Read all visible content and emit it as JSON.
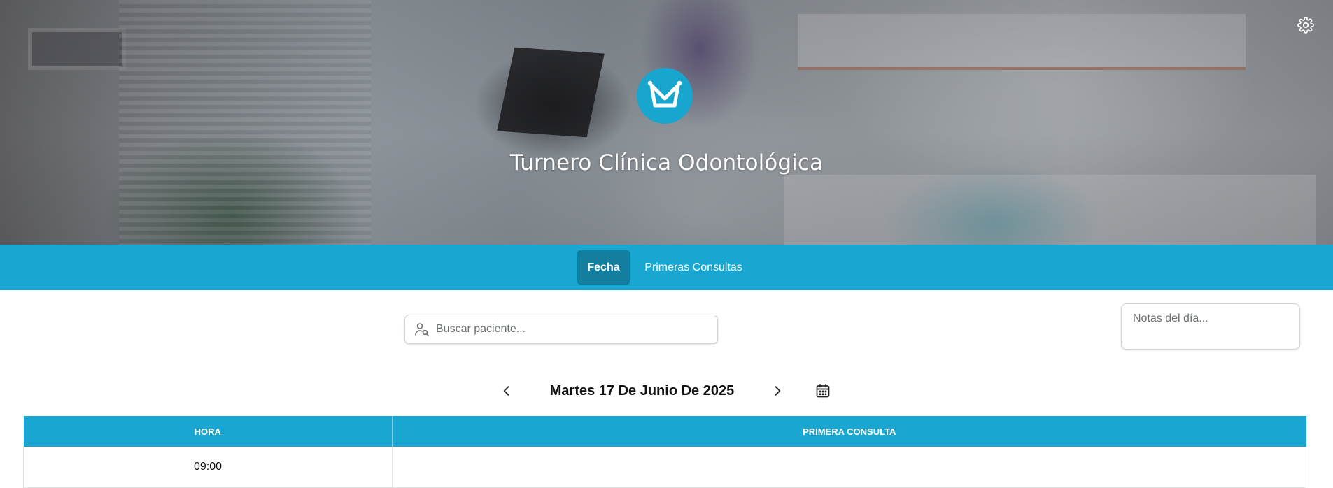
{
  "hero": {
    "title": "Turnero Clínica Odontológica",
    "logo_icon": "crown-logo-icon",
    "settings_icon": "gear-icon"
  },
  "nav": {
    "tabs": [
      {
        "label": "Fecha",
        "active": true
      },
      {
        "label": "Primeras Consultas",
        "active": false
      }
    ]
  },
  "search": {
    "placeholder": "Buscar paciente...",
    "icon": "user-search-icon"
  },
  "notes": {
    "placeholder": "Notas del día..."
  },
  "date_nav": {
    "label": "Martes 17 De Junio De 2025",
    "prev_icon": "chevron-left-icon",
    "next_icon": "chevron-right-icon",
    "calendar_icon": "calendar-icon"
  },
  "table": {
    "headers": [
      "HORA",
      "PRIMERA CONSULTA"
    ],
    "rows": [
      {
        "hora": "09:00",
        "primera_consulta": ""
      }
    ]
  },
  "colors": {
    "primary": "#19a7d1",
    "primary_dark": "#137ea0"
  }
}
